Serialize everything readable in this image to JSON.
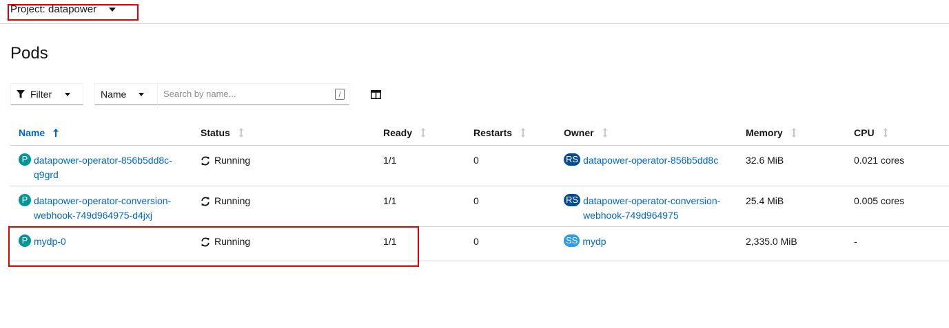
{
  "project": {
    "label": "Project: datapower"
  },
  "page": {
    "title": "Pods"
  },
  "toolbar": {
    "filter_label": "Filter",
    "name_select": "Name",
    "search_placeholder": "Search by name...",
    "search_value": "",
    "slash_hint": "/"
  },
  "columns": [
    {
      "label": "Name"
    },
    {
      "label": "Status"
    },
    {
      "label": "Ready"
    },
    {
      "label": "Restarts"
    },
    {
      "label": "Owner"
    },
    {
      "label": "Memory"
    },
    {
      "label": "CPU"
    }
  ],
  "rows": [
    {
      "badge": "P",
      "name_line1": "datapower-operator-856b5dd8c-",
      "name_line2": "q9grd",
      "status": "Running",
      "ready": "1/1",
      "restarts": "0",
      "owner_badge": "RS",
      "owner_line1": "datapower-operator-856b5dd8c",
      "owner_line2": "",
      "memory": "32.6 MiB",
      "cpu": "0.021 cores"
    },
    {
      "badge": "P",
      "name_line1": "datapower-operator-conversion-",
      "name_line2": "webhook-749d964975-d4jxj",
      "status": "Running",
      "ready": "1/1",
      "restarts": "0",
      "owner_badge": "RS",
      "owner_line1": "datapower-operator-conversion-",
      "owner_line2": "webhook-749d964975",
      "memory": "25.4 MiB",
      "cpu": "0.005 cores"
    },
    {
      "badge": "P",
      "name_line1": "mydp-0",
      "name_line2": "",
      "status": "Running",
      "ready": "1/1",
      "restarts": "0",
      "owner_badge": "SS",
      "owner_line1": "mydp",
      "owner_line2": "",
      "memory": "2,335.0 MiB",
      "cpu": "-"
    }
  ],
  "colors": {
    "link": "#0066cc",
    "pod_badge": "#009596",
    "rs_badge": "#004b95",
    "ss_badge": "#2b9af3",
    "highlight": "#e00000"
  }
}
